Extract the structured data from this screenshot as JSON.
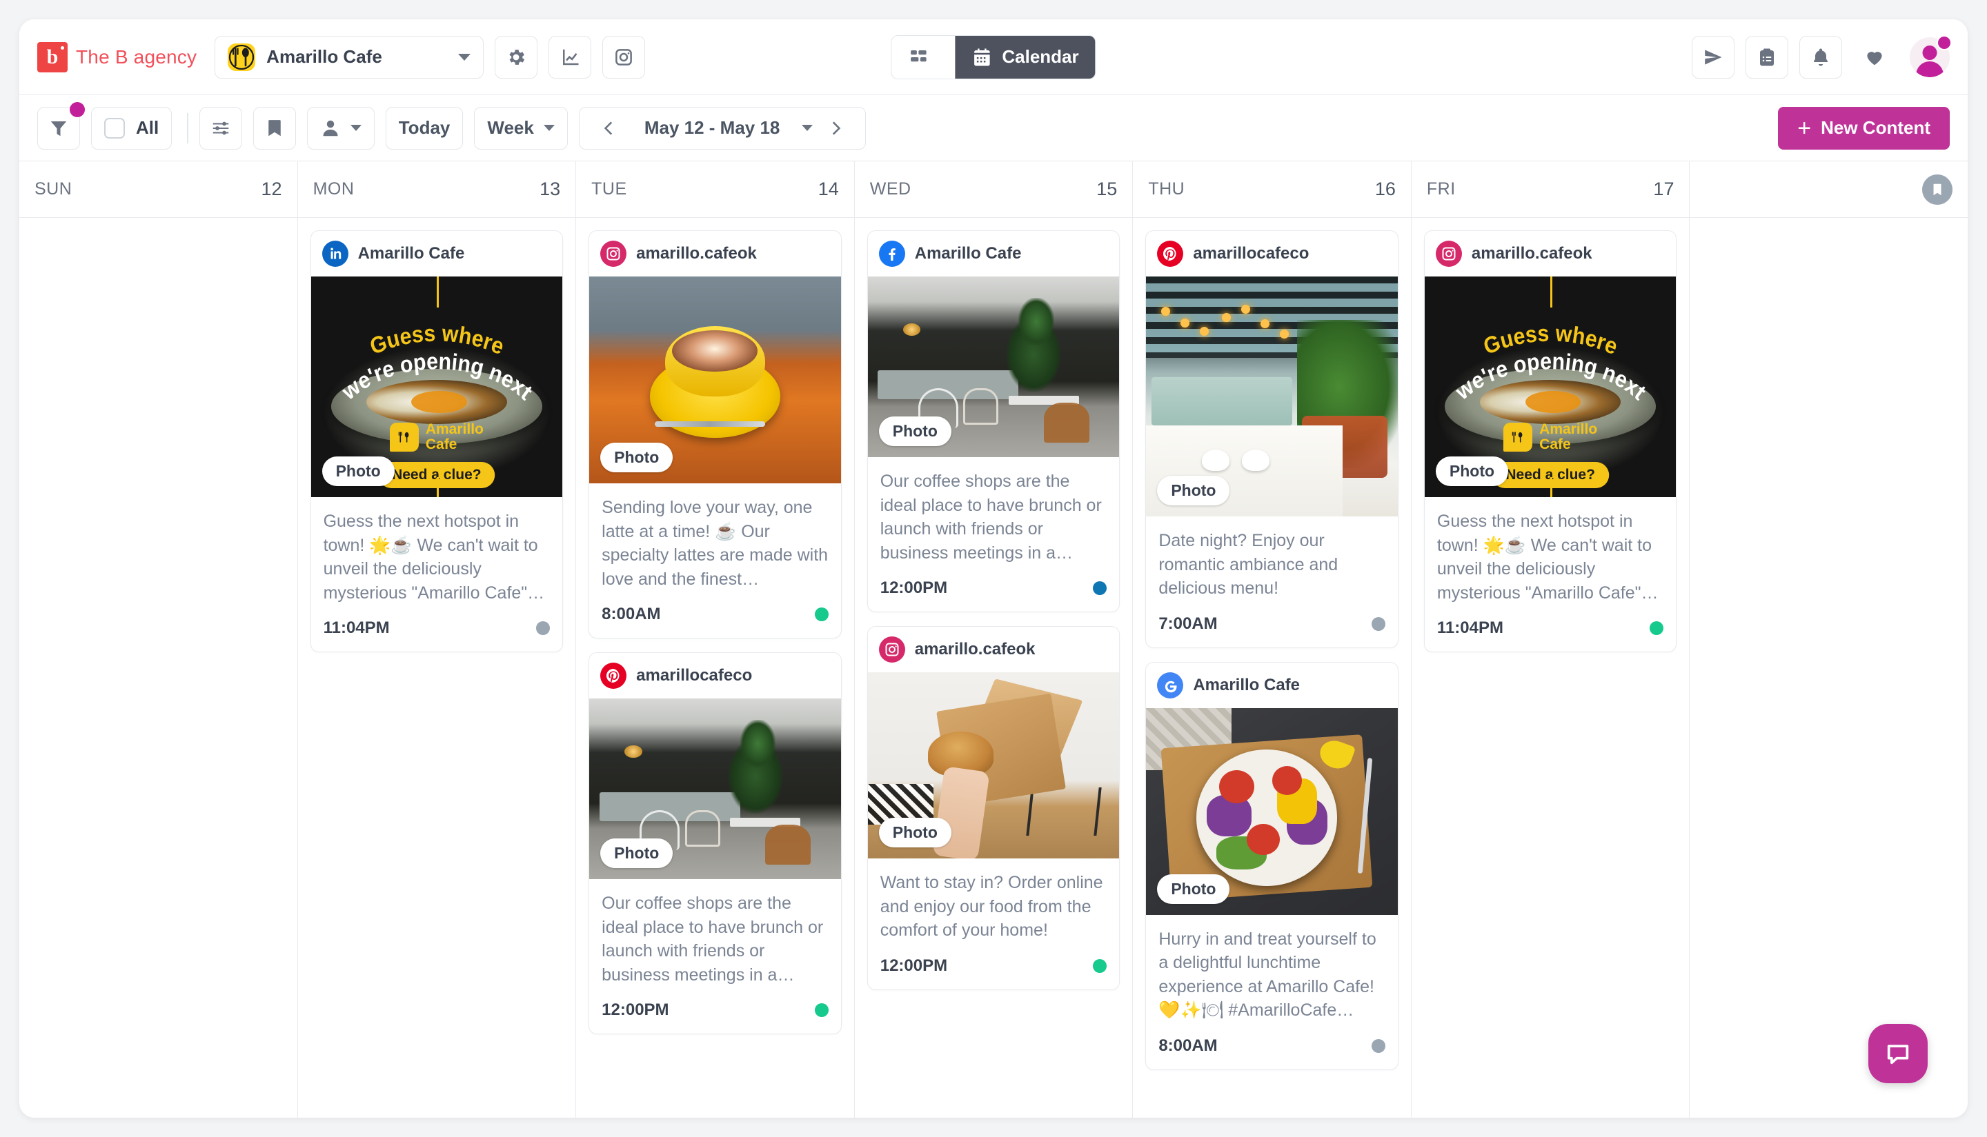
{
  "topbar": {
    "brand_mark": "b",
    "brand_name": "The B agency",
    "account_name": "Amarillo Cafe",
    "account_icon": "fork-spoon-icon",
    "settings_icon": "gear-icon",
    "analytics_icon": "analytics-chart-icon",
    "instagram_icon": "instagram-icon",
    "view_grid_label": "",
    "view_grid_icon": "grid-view-icon",
    "view_calendar_label": "Calendar",
    "view_calendar_icon": "calendar-icon",
    "right_icons": [
      "send-icon",
      "clipboard-icon",
      "bell-icon",
      "heart-icon"
    ],
    "avatar_name": "user-avatar"
  },
  "filterbar": {
    "filter_icon": "funnel-icon",
    "filter_has_badge": true,
    "all_label": "All",
    "settings_sliders_icon": "sliders-icon",
    "bookmark_icon": "bookmark-icon",
    "person_icon": "person-icon",
    "today_label": "Today",
    "period_label": "Week",
    "date_range": "May 12  -  May 18",
    "prev_icon": "chevron-left-icon",
    "next_icon": "chevron-right-icon",
    "new_content_label": "New Content",
    "new_content_plus": "+",
    "accent_color": "#bf3399"
  },
  "calendar": {
    "days": [
      {
        "dow": "SUN",
        "num": "12"
      },
      {
        "dow": "MON",
        "num": "13"
      },
      {
        "dow": "TUE",
        "num": "14"
      },
      {
        "dow": "WED",
        "num": "15"
      },
      {
        "dow": "THU",
        "num": "16"
      },
      {
        "dow": "FRI",
        "num": "17"
      },
      {
        "dow": "",
        "num": ""
      }
    ],
    "photo_tag": "Photo",
    "overlay": {
      "arc_line1": "Guess where",
      "arc_line2": "we're opening next",
      "logo_line1": "Amarillo",
      "logo_line2": "Cafe",
      "clue_pill": "Need a clue?"
    },
    "posts": {
      "mon_1": {
        "network": "linkedin",
        "account": "Amarillo Cafe",
        "text": "Guess the next hotspot in town! 🌟☕ We can't wait to unveil the deliciously mysterious \"Amarillo Cafe\"…",
        "time": "11:04PM",
        "status_color": "#9aa6b2"
      },
      "tue_1": {
        "network": "instagram",
        "account": "amarillo.cafeok",
        "text": "Sending love your way, one latte at a time! ☕ Our specialty lattes are made with love and the finest…",
        "time": "8:00AM",
        "status_color": "#16c98d"
      },
      "tue_2": {
        "network": "pinterest",
        "account": "amarillocafeco",
        "text": "Our coffee shops are the ideal place to have brunch or launch with friends or business meetings in a…",
        "time": "12:00PM",
        "status_color": "#16c98d"
      },
      "wed_1": {
        "network": "facebook",
        "account": "Amarillo Cafe",
        "text": "Our coffee shops are the ideal place to have brunch or launch with friends or business meetings in a…",
        "time": "12:00PM",
        "status_color": "#0f76b4"
      },
      "wed_2": {
        "network": "instagram",
        "account": "amarillo.cafeok",
        "text": "Want to stay in? Order online and enjoy our food from the comfort of your home!",
        "time": "12:00PM",
        "status_color": "#16c98d"
      },
      "thu_1": {
        "network": "pinterest",
        "account": "amarillocafeco",
        "text": "Date night? Enjoy our romantic ambiance and delicious menu!",
        "time": "7:00AM",
        "status_color": "#9aa6b2"
      },
      "thu_2": {
        "network": "google",
        "account": "Amarillo Cafe",
        "text": "Hurry in and treat yourself to a delightful lunchtime experience at Amarillo Cafe! 💛✨🍽 #AmarilloCafe…",
        "time": "8:00AM",
        "status_color": "#9aa6b2"
      },
      "fri_1": {
        "network": "instagram",
        "account": "amarillo.cafeok",
        "text": "Guess the next hotspot in town! 🌟☕ We can't wait to unveil the deliciously mysterious \"Amarillo Cafe\"…",
        "time": "11:04PM",
        "status_color": "#16c98d"
      }
    }
  },
  "help": {
    "icon": "chat-bubble-icon"
  }
}
